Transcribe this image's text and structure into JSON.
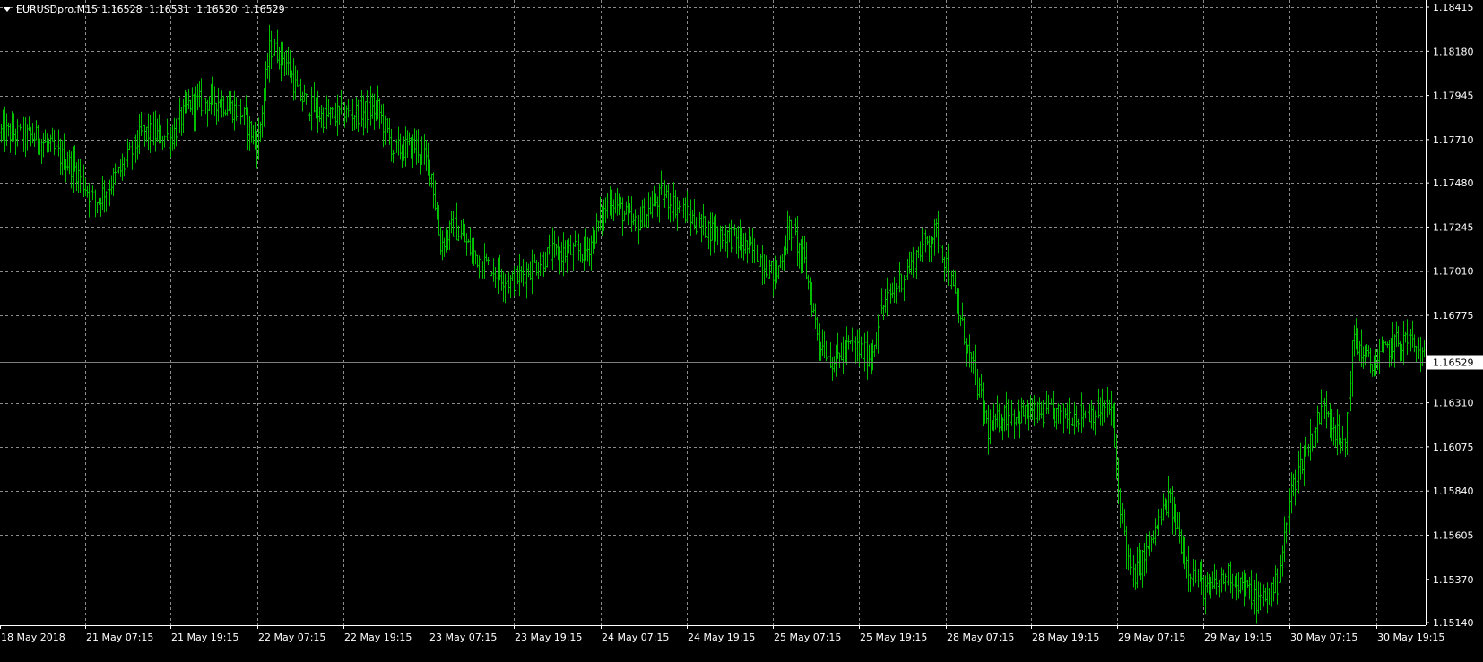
{
  "header": {
    "symbol": "EURUSDpro,M15",
    "open": "1.16528",
    "high": "1.16531",
    "low": "1.16520",
    "close": "1.16529"
  },
  "colors": {
    "background": "#000000",
    "candle": "#00c000",
    "grid": "#8c8c8c",
    "axis_text": "#ffffff",
    "price_line": "#7f7f7f",
    "price_label_bg": "#ffffff",
    "price_label_text": "#000000"
  },
  "chart_data": {
    "type": "bar",
    "instrument": "EURUSDpro",
    "timeframe": "M15",
    "grid": true,
    "current_price": 1.16529,
    "ylim": [
      1.1514,
      1.18415
    ],
    "y_ticks": [
      1.18415,
      1.1818,
      1.17945,
      1.1771,
      1.1748,
      1.17245,
      1.1701,
      1.16775,
      1.1631,
      1.16075,
      1.1584,
      1.15605,
      1.1537,
      1.1514
    ],
    "y_tick_labels": [
      "1.18415",
      "1.18180",
      "1.17945",
      "1.17710",
      "1.17480",
      "1.17245",
      "1.17010",
      "1.16775",
      "1.16310",
      "1.16075",
      "1.15840",
      "1.15605",
      "1.15370",
      "1.15140"
    ],
    "current_price_label": "1.16529",
    "x_tick_labels": [
      "18 May 2018",
      "21 May 07:15",
      "21 May 19:15",
      "22 May 07:15",
      "22 May 19:15",
      "23 May 07:15",
      "23 May 19:15",
      "24 May 07:15",
      "24 May 19:15",
      "25 May 07:15",
      "25 May 19:15",
      "28 May 07:15",
      "28 May 19:15",
      "29 May 07:15",
      "29 May 19:15",
      "30 May 07:15",
      "30 May 19:15"
    ],
    "price_path": [
      [
        0,
        1.1775
      ],
      [
        40,
        1.1772
      ],
      [
        80,
        1.1755
      ],
      [
        100,
        1.1738
      ],
      [
        130,
        1.1756
      ],
      [
        150,
        1.1775
      ],
      [
        180,
        1.1772
      ],
      [
        200,
        1.179
      ],
      [
        230,
        1.1792
      ],
      [
        255,
        1.1785
      ],
      [
        272,
        1.1768
      ],
      [
        285,
        1.182
      ],
      [
        300,
        1.1815
      ],
      [
        315,
        1.1795
      ],
      [
        340,
        1.1783
      ],
      [
        370,
        1.1785
      ],
      [
        400,
        1.1787
      ],
      [
        415,
        1.1765
      ],
      [
        440,
        1.1768
      ],
      [
        455,
        1.1755
      ],
      [
        465,
        1.1715
      ],
      [
        480,
        1.1725
      ],
      [
        500,
        1.171
      ],
      [
        540,
        1.1695
      ],
      [
        580,
        1.171
      ],
      [
        620,
        1.1712
      ],
      [
        645,
        1.174
      ],
      [
        670,
        1.1725
      ],
      [
        700,
        1.1742
      ],
      [
        740,
        1.1725
      ],
      [
        770,
        1.172
      ],
      [
        800,
        1.171
      ],
      [
        820,
        1.1698
      ],
      [
        835,
        1.1725
      ],
      [
        850,
        1.1705
      ],
      [
        865,
        1.1665
      ],
      [
        880,
        1.1653
      ],
      [
        900,
        1.1662
      ],
      [
        920,
        1.1655
      ],
      [
        930,
        1.168
      ],
      [
        950,
        1.1695
      ],
      [
        975,
        1.1715
      ],
      [
        990,
        1.1722
      ],
      [
        1005,
        1.1695
      ],
      [
        1020,
        1.1665
      ],
      [
        1035,
        1.1635
      ],
      [
        1045,
        1.1615
      ],
      [
        1060,
        1.1625
      ],
      [
        1100,
        1.1625
      ],
      [
        1140,
        1.1625
      ],
      [
        1175,
        1.1628
      ],
      [
        1182,
        1.1585
      ],
      [
        1195,
        1.1535
      ],
      [
        1215,
        1.1555
      ],
      [
        1235,
        1.158
      ],
      [
        1255,
        1.1545
      ],
      [
        1275,
        1.153
      ],
      [
        1300,
        1.154
      ],
      [
        1330,
        1.1525
      ],
      [
        1350,
        1.1535
      ],
      [
        1365,
        1.1585
      ],
      [
        1385,
        1.1612
      ],
      [
        1400,
        1.1632
      ],
      [
        1420,
        1.1605
      ],
      [
        1430,
        1.1665
      ],
      [
        1450,
        1.165
      ],
      [
        1470,
        1.1662
      ],
      [
        1490,
        1.1665
      ],
      [
        1505,
        1.1653
      ]
    ]
  }
}
